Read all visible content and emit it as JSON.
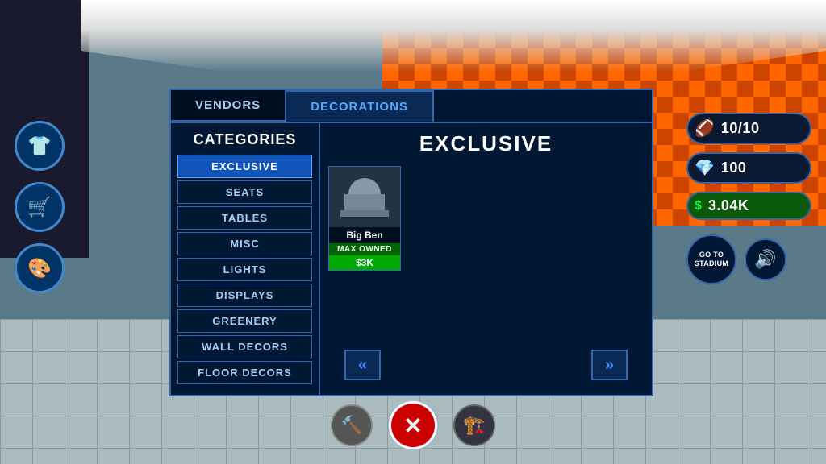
{
  "background": {
    "checkerColor1": "#cc4400",
    "checkerColor2": "#ff6600"
  },
  "tabs": [
    {
      "id": "vendors",
      "label": "VENDORS",
      "active": false
    },
    {
      "id": "decorations",
      "label": "DECORATIONS",
      "active": true
    }
  ],
  "categories": {
    "title": "CATEGORIES",
    "items": [
      {
        "id": "exclusive",
        "label": "EXCLUSIVE",
        "active": true
      },
      {
        "id": "seats",
        "label": "SEATS",
        "active": false
      },
      {
        "id": "tables",
        "label": "TABLES",
        "active": false
      },
      {
        "id": "misc",
        "label": "MISC",
        "active": false
      },
      {
        "id": "lights",
        "label": "LIGHTS",
        "active": false
      },
      {
        "id": "displays",
        "label": "DISPLAYS",
        "active": false
      },
      {
        "id": "greenery",
        "label": "GREENERY",
        "active": false
      },
      {
        "id": "wall_decors",
        "label": "WALL DECORS",
        "active": false
      },
      {
        "id": "floor_decors",
        "label": "FLOOR DECORS",
        "active": false
      }
    ]
  },
  "content": {
    "section_title": "EXCLUSIVE",
    "items": [
      {
        "id": "big_ben",
        "name": "Big Ben",
        "owned": true,
        "owned_label": "MAX OWNED",
        "price": "$3K",
        "icon": "🏛️"
      }
    ],
    "nav": {
      "prev_label": "«",
      "next_label": "»"
    }
  },
  "hud": {
    "football_icon": "🏈",
    "football_value": "10/10",
    "diamond_icon": "💎",
    "diamond_value": "100",
    "money_icon": "$",
    "money_value": "3.04K",
    "go_to_stadium_label": "GO TO\nSTADIUM",
    "sound_icon": "🔊"
  },
  "left_sidebar": {
    "icons": [
      {
        "id": "shirt",
        "icon": "👕"
      },
      {
        "id": "cart",
        "icon": "🛒"
      },
      {
        "id": "paint",
        "icon": "🎨"
      }
    ]
  },
  "bottom_toolbar": {
    "tools": [
      {
        "id": "hammer",
        "icon": "🔨"
      },
      {
        "id": "close",
        "icon": "✕"
      },
      {
        "id": "build",
        "icon": "🏗️"
      }
    ]
  }
}
